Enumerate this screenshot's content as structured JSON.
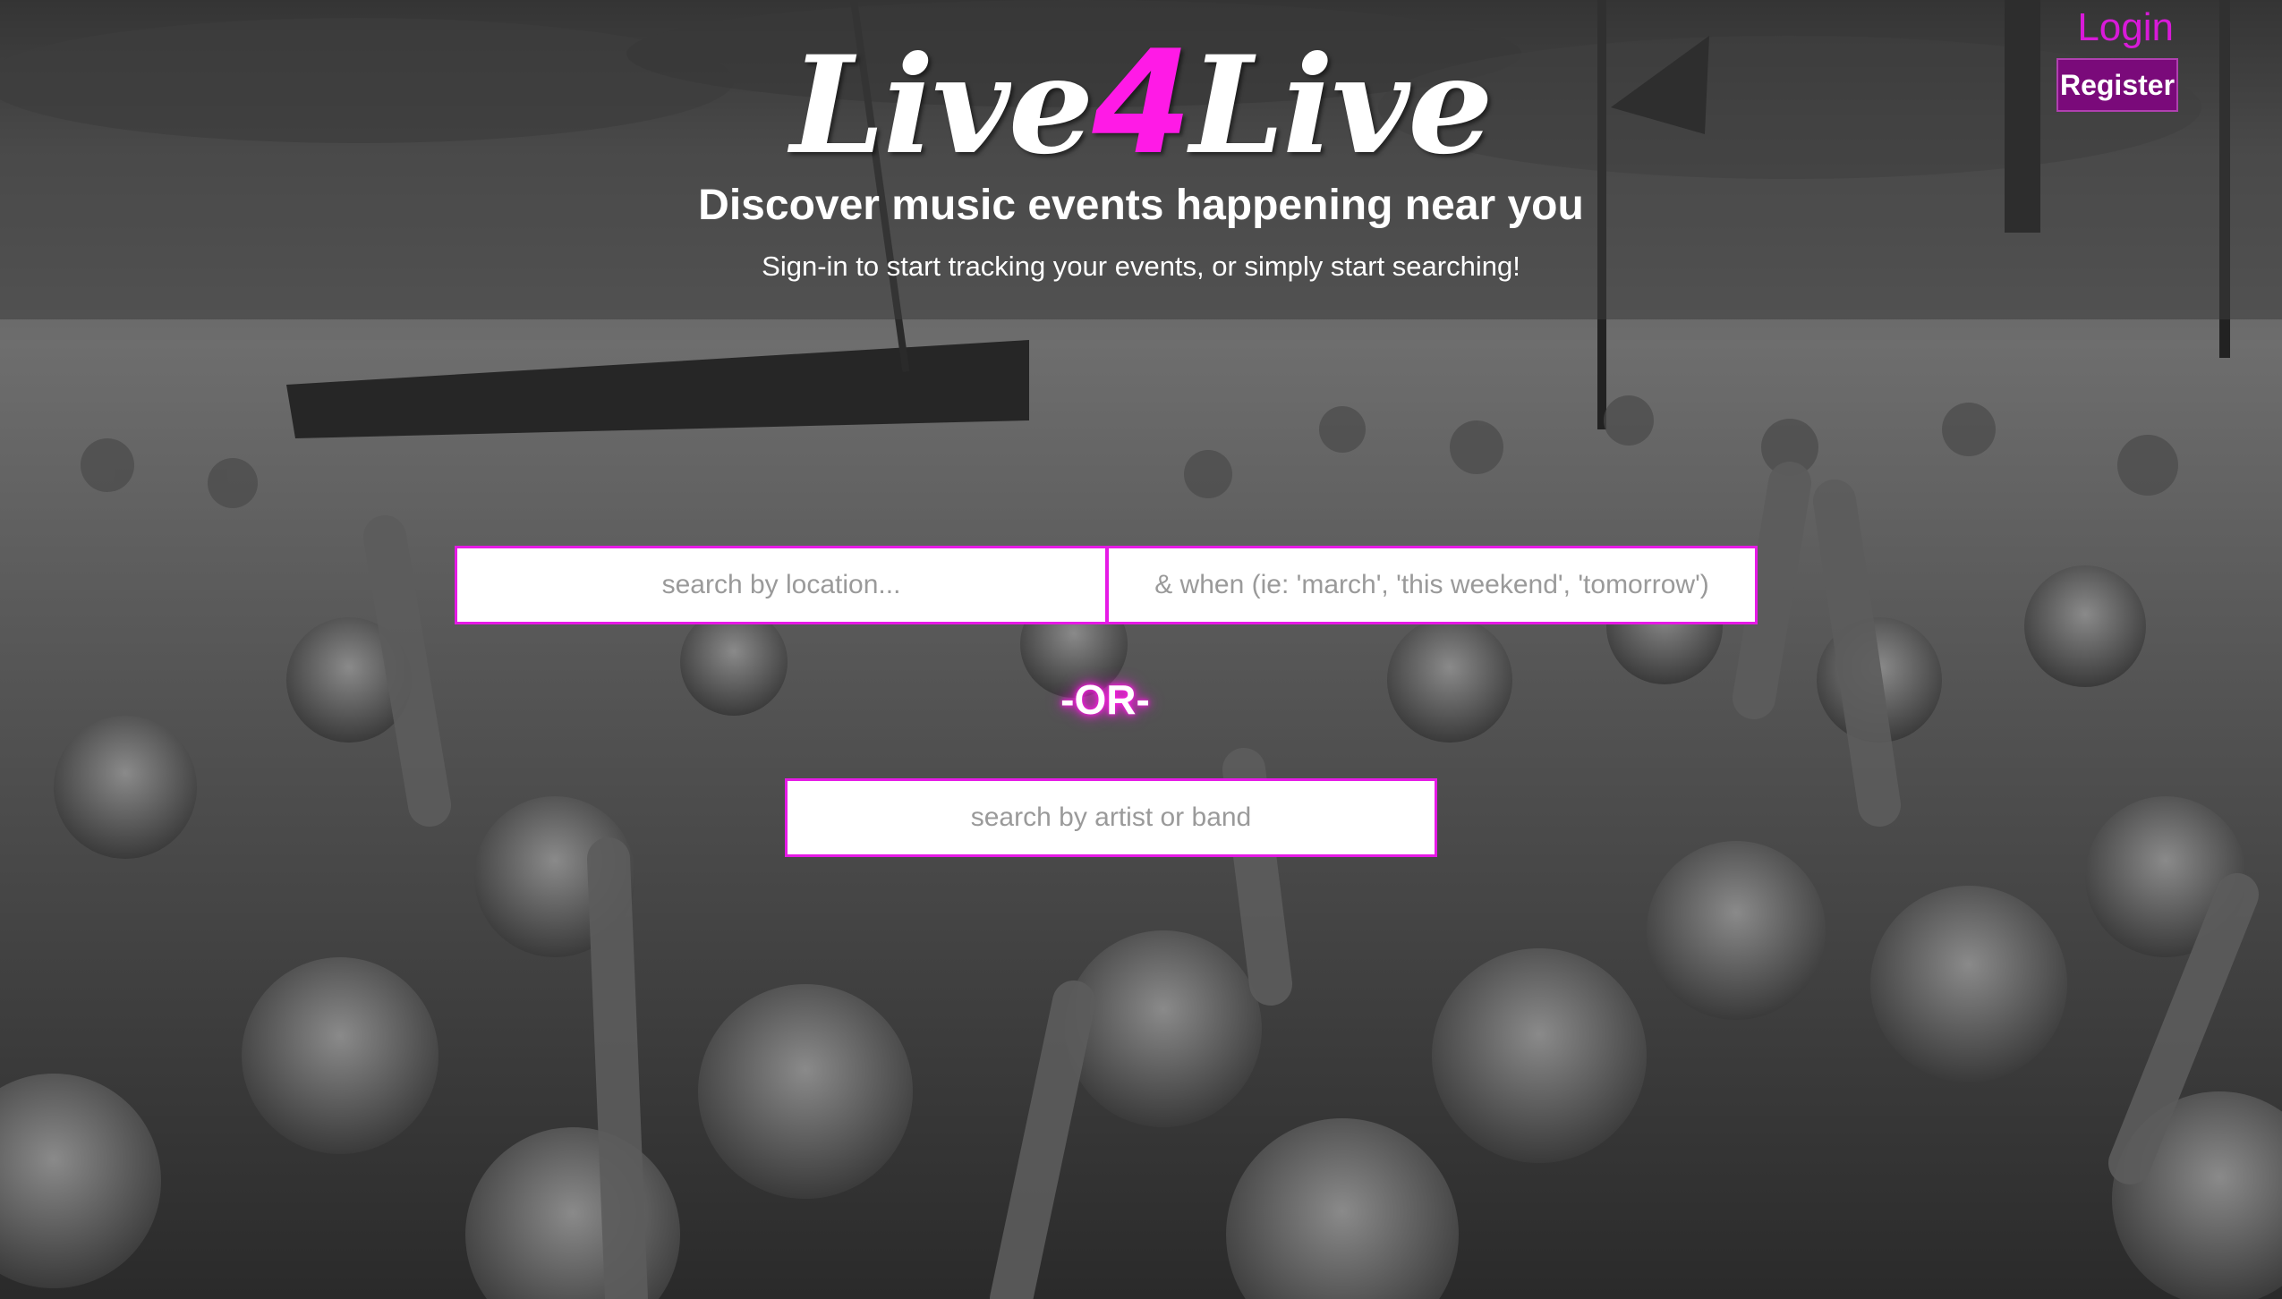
{
  "brand": {
    "logo_part1": "Live",
    "logo_accent": "4",
    "logo_part2": "Live",
    "accent_color": "#ff1ae6"
  },
  "header": {
    "tagline": "Discover music events happening near you",
    "subtagline": "Sign-in to start tracking your events, or simply start searching!"
  },
  "auth": {
    "login_label": "Login",
    "register_label": "Register"
  },
  "search": {
    "location_placeholder": "search by location...",
    "when_placeholder": "& when (ie: 'march', 'this weekend', 'tomorrow')",
    "or_label": "-OR-",
    "artist_placeholder": "search by artist or band"
  },
  "background": {
    "description_icon": "crowd-photo"
  }
}
